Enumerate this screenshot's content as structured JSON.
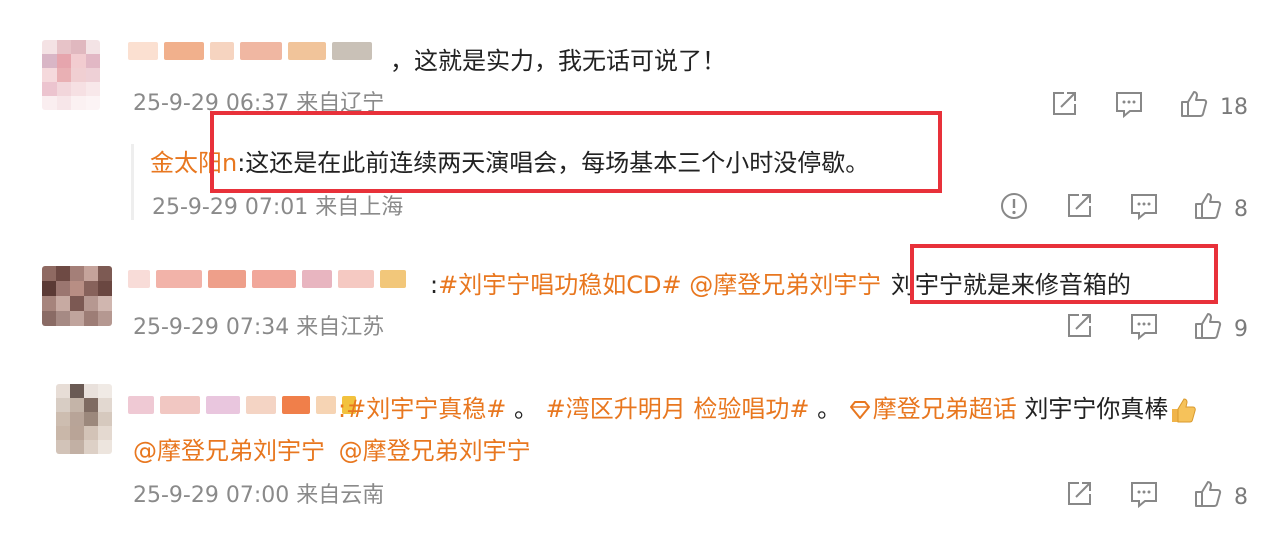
{
  "comments": [
    {
      "text": "，这就是实力，我无话可说了！",
      "meta": "25-9-29 06:37 来自辽宁",
      "like_count": "18"
    },
    {
      "reply_author": "金太阳n",
      "reply_text": ":这还是在此前连续两天演唱会，每场基本三个小时没停歇。",
      "meta": "25-9-29 07:01 来自上海",
      "like_count": "8"
    },
    {
      "prefix": ":",
      "hashtag": "#刘宇宁唱功稳如CD#",
      "mention": "@摩登兄弟刘宇宁",
      "text": "刘宇宁就是来修音箱的",
      "meta": "25-9-29 07:34 来自江苏",
      "like_count": "9"
    },
    {
      "hashtag1": ":#刘宇宁真稳#",
      "sep1": "。",
      "hashtag2": "#湾区升明月 检验唱功#",
      "sep2": "。",
      "supertopic": "摩登兄弟超话",
      "text": "刘宇宁你真棒",
      "mention1": "@摩登兄弟刘宇宁",
      "mention2": "@摩登兄弟刘宇宁",
      "meta": "25-9-29 07:00 来自云南",
      "like_count": "8"
    }
  ],
  "colors": {
    "accent": "#e8771f",
    "highlight_box": "#e8313a",
    "meta_text": "#8a8a8a"
  }
}
